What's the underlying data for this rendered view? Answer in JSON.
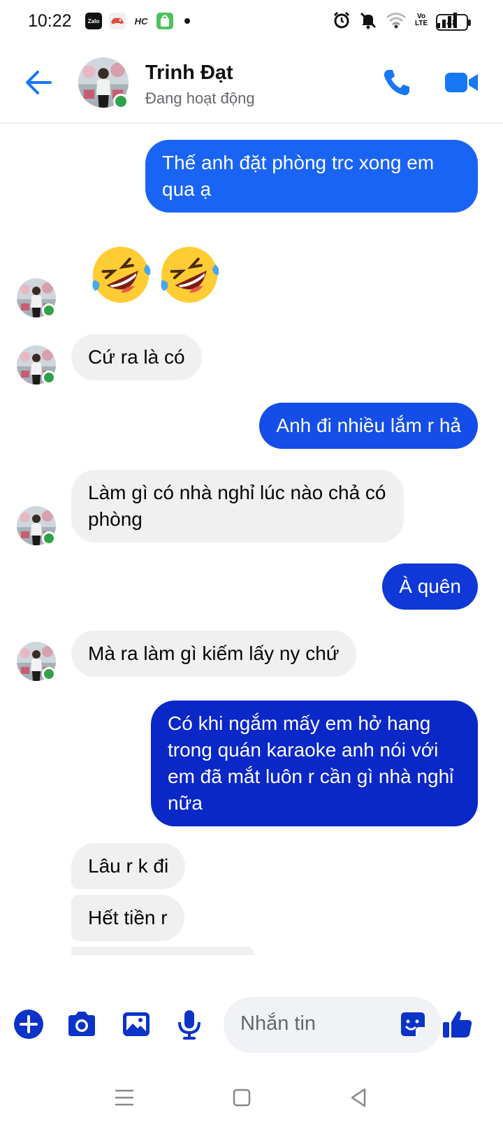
{
  "status_bar": {
    "time": "10:22",
    "apps": [
      "Zalo",
      "",
      "HC",
      ""
    ],
    "network": "Vo LTE",
    "battery": "48"
  },
  "header": {
    "contact_name": "Trinh Đạt",
    "contact_status": "Đang hoạt động"
  },
  "messages": [
    {
      "id": "m1",
      "side": "out",
      "text": "Thế anh đặt phòng trc xong em qua ạ",
      "color": "#1a64f5"
    },
    {
      "id": "m2",
      "side": "in",
      "emojis": [
        "rolling-on-floor-laughing",
        "rolling-on-floor-laughing"
      ]
    },
    {
      "id": "m3",
      "side": "in",
      "text": "Cứ ra là có"
    },
    {
      "id": "m4",
      "side": "out",
      "text": "Anh đi nhiều lắm r hả",
      "color": "#144de8"
    },
    {
      "id": "m5",
      "side": "in",
      "text": "Làm gì có nhà nghỉ lúc nào chả có phòng"
    },
    {
      "id": "m6",
      "side": "out",
      "text": "À quên",
      "color": "#1038d8"
    },
    {
      "id": "m7",
      "side": "in",
      "text": "Mà ra làm gì kiếm lấy ny chứ"
    },
    {
      "id": "m8",
      "side": "out",
      "text": "Có khi ngắm mấy em hở hang trong quán karaoke anh nói với em đã mắt luôn r cần gì nhà nghỉ nữa",
      "color": "#0a27c8"
    },
    {
      "id": "m9",
      "side": "in",
      "text": "Lâu r k đi"
    },
    {
      "id": "m10",
      "side": "in",
      "text": "Hết tiền r"
    }
  ],
  "composer": {
    "placeholder": "Nhắn tin"
  },
  "colors": {
    "accent": "#1877f2",
    "online": "#31a24c",
    "incoming_bubble": "#f0f0f0"
  }
}
